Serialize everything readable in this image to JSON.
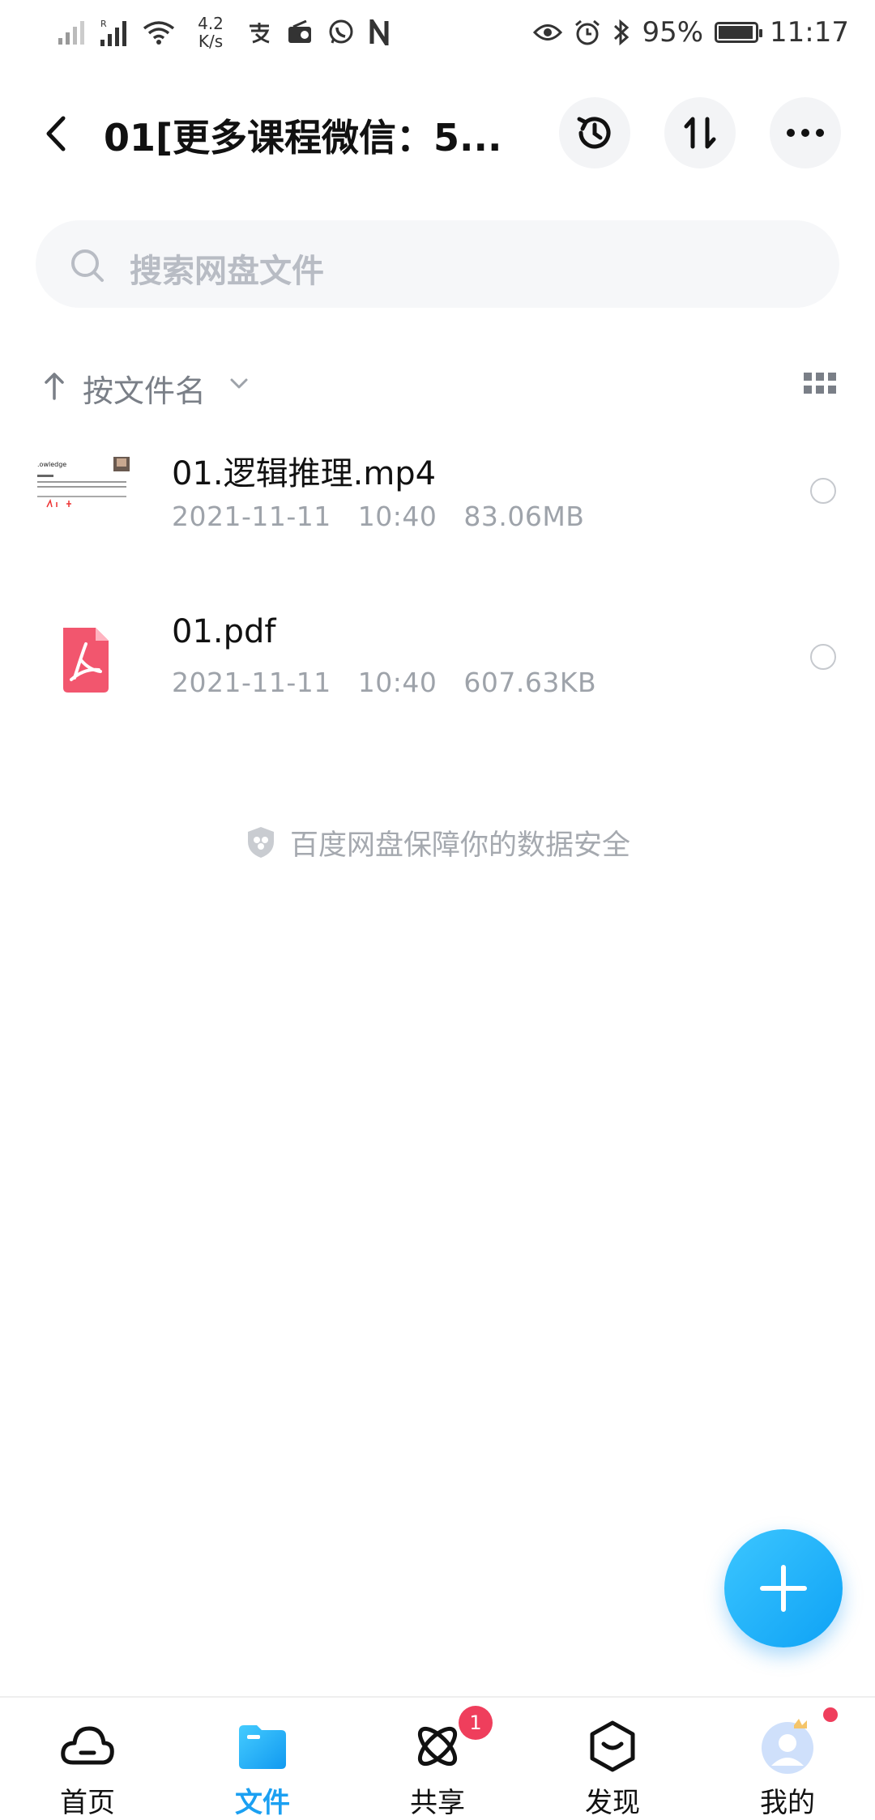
{
  "status_bar": {
    "net_speed": "4.2",
    "net_speed_unit": "K/s",
    "battery": "95%",
    "battery_level": 0.95,
    "time": "11:17"
  },
  "header": {
    "title": "01[更多课程微信：5..."
  },
  "search": {
    "placeholder": "搜索网盘文件"
  },
  "sort": {
    "label": "按文件名"
  },
  "files": [
    {
      "name": "01.逻辑推理.mp4",
      "date": "2021-11-11",
      "time": "10:40",
      "size": "83.06MB",
      "type": "video"
    },
    {
      "name": "01.pdf",
      "date": "2021-11-11",
      "time": "10:40",
      "size": "607.63KB",
      "type": "pdf"
    }
  ],
  "footer_note": "百度网盘保障你的数据安全",
  "nav": [
    {
      "label": "首页",
      "icon": "cloud-icon"
    },
    {
      "label": "文件",
      "icon": "folder-icon",
      "active": true
    },
    {
      "label": "共享",
      "icon": "share-orbit-icon",
      "badge": "1"
    },
    {
      "label": "发现",
      "icon": "discover-icon"
    },
    {
      "label": "我的",
      "icon": "avatar-icon"
    }
  ],
  "colors": {
    "accent": "#1ba0f2",
    "badge": "#ef3e5c",
    "pdf": "#f2566e"
  }
}
